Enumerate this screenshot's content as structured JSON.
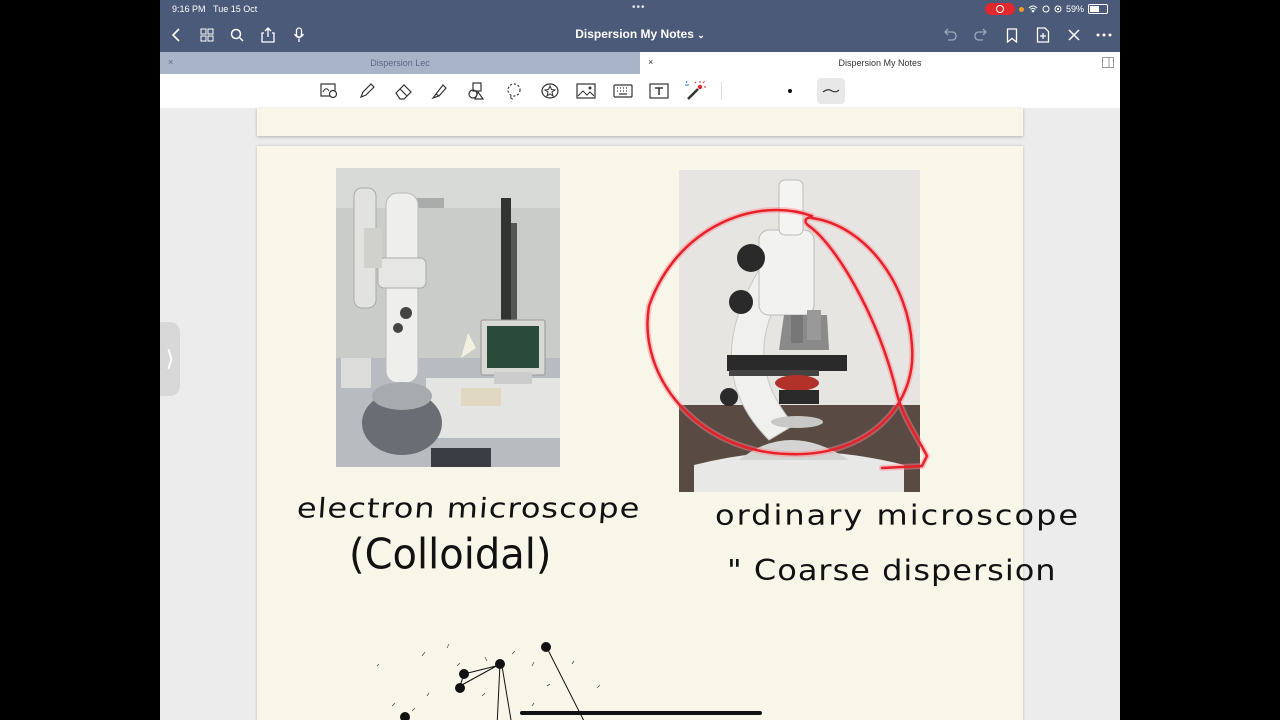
{
  "status": {
    "time": "9:16 PM",
    "date": "Tue 15 Oct",
    "battery": "59%"
  },
  "nav": {
    "title": "Dispersion My Notes",
    "title_chevron": "⌄"
  },
  "tabs": [
    {
      "label": "Dispersion Lec",
      "close": "×"
    },
    {
      "label": "Dispersion My Notes",
      "close": "×"
    }
  ],
  "toolbar": {
    "tools": [
      "lasso-zoom-icon",
      "pen-icon",
      "eraser-icon",
      "highlighter-icon",
      "shapes-icon",
      "lasso-icon",
      "sticker-icon",
      "image-icon",
      "keyboard-icon",
      "text-icon",
      "laser-pointer-icon"
    ]
  },
  "notes": {
    "left_caption": "electron microscope",
    "left_sub": "(Colloidal)",
    "right_caption": "ordinary microscope",
    "right_sub": "\" Coarse dispersion"
  },
  "photos": {
    "left": "electron-microscope-photo",
    "right": "ordinary-microscope-photo"
  },
  "colors": {
    "nav": "#4a5a78",
    "tab_inactive": "#a8b4c8",
    "paper": "#f8f6e9",
    "annotation": "#e8202a"
  }
}
